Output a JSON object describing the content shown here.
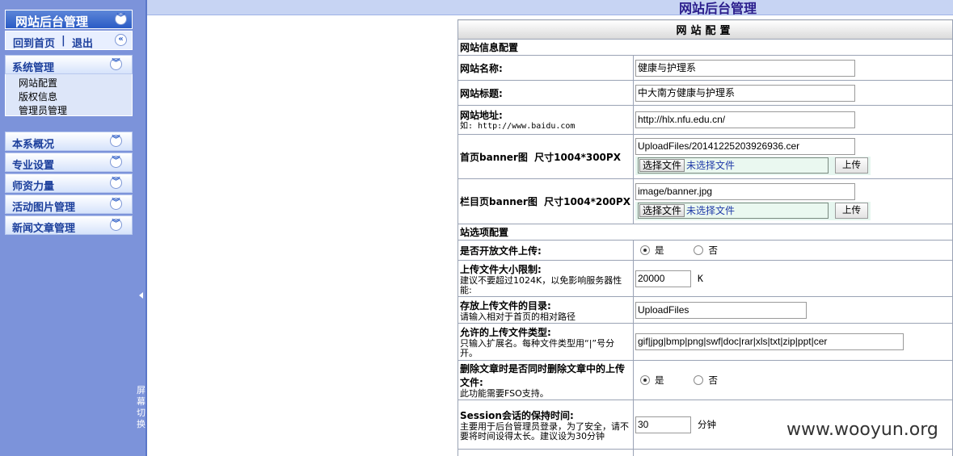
{
  "sidebar": {
    "header_title": "网站后台管理",
    "home_link": "回到首页",
    "separator": "|",
    "logout_link": "退出",
    "groups": [
      {
        "label": "系统管理",
        "items": [
          "网站配置",
          "版权信息",
          "管理员管理"
        ]
      },
      {
        "label": "本系概况"
      },
      {
        "label": "专业设置"
      },
      {
        "label": "师资力量"
      },
      {
        "label": "活动图片管理"
      },
      {
        "label": "新闻文章管理"
      }
    ]
  },
  "splitter": {
    "label": "屏幕切换"
  },
  "topbar": {
    "title": "网站后台管理"
  },
  "config": {
    "caption": "网站配置",
    "section_site": "网站信息配置",
    "site_name": {
      "label": "网站名称:",
      "value": "健康与护理系"
    },
    "site_title": {
      "label": "网站标题:",
      "value": "中大南方健康与护理系"
    },
    "site_url": {
      "label": "网站地址:",
      "hint": "如: http://www.baidu.com",
      "value": "http://hlx.nfu.edu.cn/"
    },
    "home_banner": {
      "label": "首页banner图  尺寸1004*300PX",
      "value": "UploadFiles/20141225203926936.cer",
      "choose": "选择文件",
      "no_file": "未选择文件",
      "upload": "上传"
    },
    "column_banner": {
      "label": "栏目页banner图  尺寸1004*200PX",
      "value": "image/banner.jpg",
      "choose": "选择文件",
      "no_file": "未选择文件",
      "upload": "上传"
    },
    "section_options": "站选项配置",
    "allow_upload": {
      "label": "是否开放文件上传:",
      "yes": "是",
      "no": "否",
      "selected": "yes"
    },
    "size_limit": {
      "label": "上传文件大小限制:",
      "hint": "建议不要超过1024K，以免影响服务器性能:",
      "value": "20000",
      "unit": "K"
    },
    "upload_dir": {
      "label": "存放上传文件的目录:",
      "hint": "请输入相对于首页的相对路径",
      "value": "UploadFiles"
    },
    "allowed_types": {
      "label": "允许的上传文件类型:",
      "hint": "只输入扩展名。每种文件类型用“|”号分开。",
      "value": "gif|jpg|bmp|png|swf|doc|rar|xls|txt|zip|ppt|cer"
    },
    "delete_files": {
      "label": "删除文章时是否同时删除文章中的上传文件:",
      "hint": "此功能需要FSO支持。",
      "yes": "是",
      "no": "否",
      "selected": "yes"
    },
    "session": {
      "label": "Session会话的保持时间:",
      "hint": "主要用于后台管理员登录，为了安全，请不要将时间设得太长。建议设为30分钟",
      "value": "30",
      "unit": "分钟"
    }
  },
  "watermark": "www.wooyun.org"
}
